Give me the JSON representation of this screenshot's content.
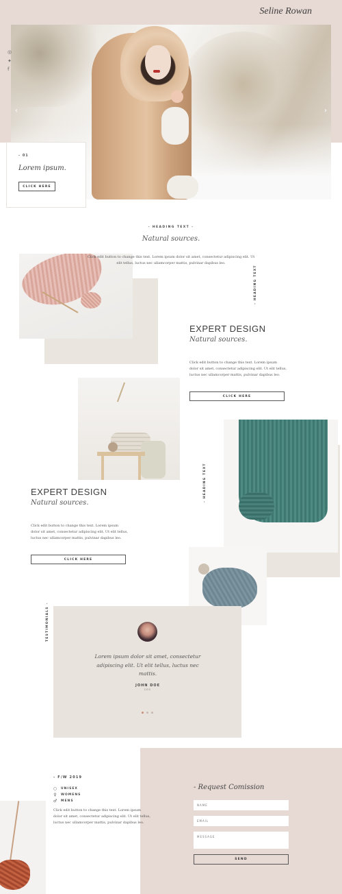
{
  "header": {
    "brand": "Seline Rowan"
  },
  "hero": {
    "slide_number": "- 01",
    "title": "Lorem ipsum.",
    "button_label": "CLICK HERE",
    "social_icons": [
      "instagram-icon",
      "twitter-icon",
      "facebook-icon"
    ]
  },
  "section1": {
    "kicker": "- HEADING TEXT -",
    "title": "Natural sources.",
    "text": "Click edit button to change this text. Lorem ipsum dolor sit amet, consectetur adipiscing elit. Ut elit tellus, luctus nec ullamcorper mattis, pulvinar dapibus leo.",
    "vertical_label": "- HEADING TEXT"
  },
  "feature1": {
    "title": "EXPERT DESIGN",
    "subtitle": "Natural sources.",
    "text": "Click edit button to change this text. Lorem ipsum dolor sit amet, consectetur adipiscing elit. Ut elit tellus, luctus nec ullamcorper mattis, pulvinar dapibus leo.",
    "button_label": "CLICK HERE"
  },
  "feature2": {
    "title": "EXPERT DESIGN",
    "subtitle": "Natural sources.",
    "text": "Click edit button to change this text. Lorem ipsum dolor sit amet, consectetur adipiscing elit. Ut elit tellus, luctus nec ullamcorper mattis, pulvinar dapibus leo.",
    "button_label": "CLICK HERE",
    "vertical_label": "- HEADING TEXT"
  },
  "testimonials": {
    "vertical_label": "TESTIMONIALS -",
    "quote": "Lorem ipsum dolor sit amet, consectetur adipiscing elit. Ut elit tellus, luctus nec mattis.",
    "name": "JOHN DOE",
    "role": "CEO",
    "active_slide": 1,
    "slide_count": 3
  },
  "footer": {
    "collection_label": "- F/W 2019",
    "items": [
      {
        "icon": "circle-icon",
        "label": "UNISEX"
      },
      {
        "icon": "female-icon",
        "label": "WOMENS"
      },
      {
        "icon": "male-icon",
        "label": "MENS"
      }
    ],
    "text": "Click edit button to change this text. Lorem ipsum dolor sit amet, consectetur adipiscing elit. Ut elit tellus, luctus nec ullamcorper mattis, pulvinar dapibus leo."
  },
  "form": {
    "title": "- Request Comission",
    "name_placeholder": "NAME",
    "email_placeholder": "EMAIL",
    "message_placeholder": "MESSAGE",
    "send_label": "SEND"
  },
  "colors": {
    "blush": "#e7d9d3",
    "beige": "#eae5de",
    "testimonial_bg": "#e8e4dd",
    "text": "#3b3b3b",
    "dot_active": "#c98f79"
  }
}
